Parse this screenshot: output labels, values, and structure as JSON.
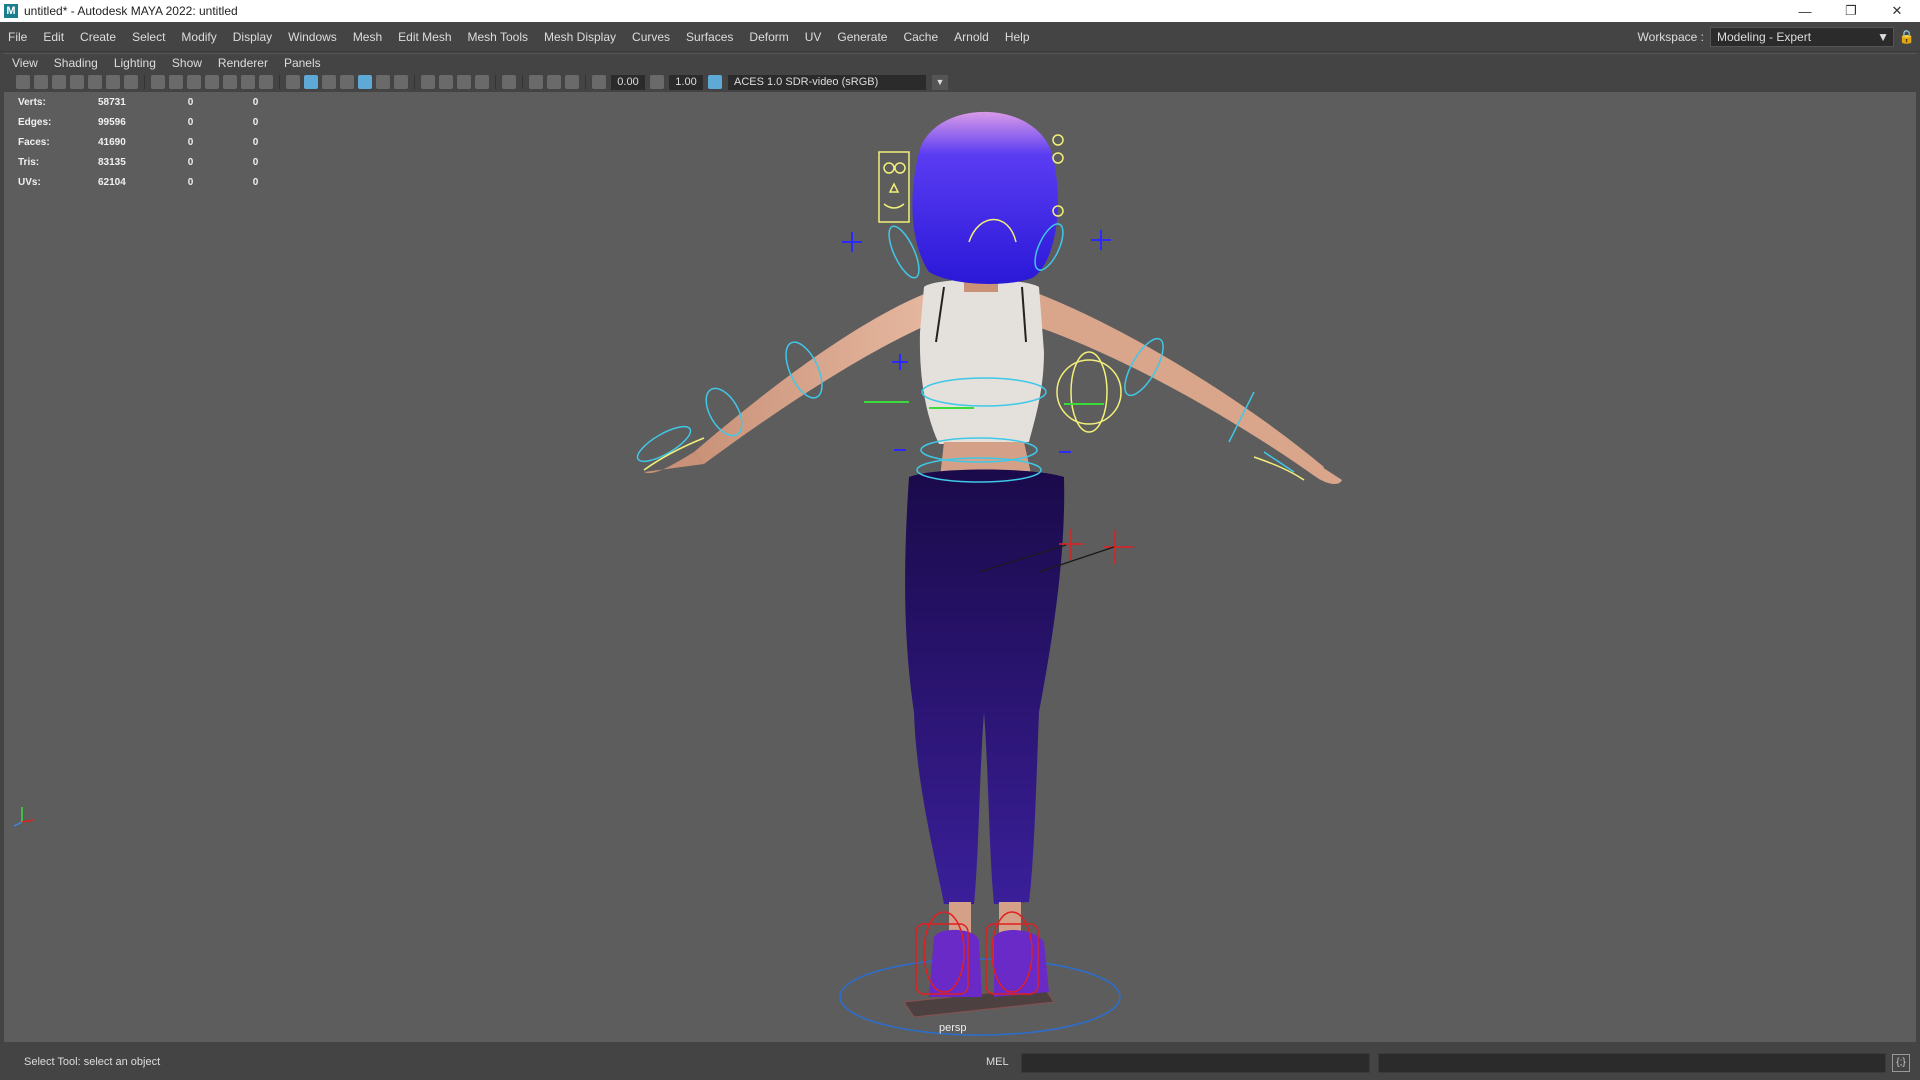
{
  "window": {
    "title": "untitled* - Autodesk MAYA 2022: untitled",
    "app_icon": "M",
    "minimize_icon": "—",
    "restore_icon": "❐",
    "close_icon": "✕"
  },
  "menubar": {
    "items": [
      "File",
      "Edit",
      "Create",
      "Select",
      "Modify",
      "Display",
      "Windows",
      "Mesh",
      "Edit Mesh",
      "Mesh Tools",
      "Mesh Display",
      "Curves",
      "Surfaces",
      "Deform",
      "UV",
      "Generate",
      "Cache",
      "Arnold",
      "Help"
    ],
    "workspace_label": "Workspace :",
    "workspace_value": "Modeling - Expert",
    "dropdown_arrow": "▼",
    "lock_icon": "🔒"
  },
  "panel_menu": {
    "items": [
      "View",
      "Shading",
      "Lighting",
      "Show",
      "Renderer",
      "Panels"
    ]
  },
  "panel_toolbar": {
    "exposure": "0.00",
    "gamma": "1.00",
    "color_space": "ACES 1.0 SDR-video (sRGB)",
    "dropdown_arrow": "▼"
  },
  "hud": {
    "rows": [
      {
        "label": "Verts:",
        "v1": "58731",
        "v2": "0",
        "v3": "0"
      },
      {
        "label": "Edges:",
        "v1": "99596",
        "v2": "0",
        "v3": "0"
      },
      {
        "label": "Faces:",
        "v1": "41690",
        "v2": "0",
        "v3": "0"
      },
      {
        "label": "Tris:",
        "v1": "83135",
        "v2": "0",
        "v3": "0"
      },
      {
        "label": "UVs:",
        "v1": "62104",
        "v2": "0",
        "v3": "0"
      }
    ]
  },
  "viewport": {
    "camera": "persp",
    "colors": {
      "background": "#5d5d5d",
      "hair": "#3b2ee0",
      "pants": "#2a1470",
      "control_cyan": "#3fc8e8",
      "control_yellow": "#f2f07a",
      "control_blue": "#2a2aff",
      "control_red": "#e02020"
    }
  },
  "status": {
    "help_line": "Select Tool: select an object",
    "mel_label": "MEL",
    "script_editor_icon": "{;}"
  }
}
